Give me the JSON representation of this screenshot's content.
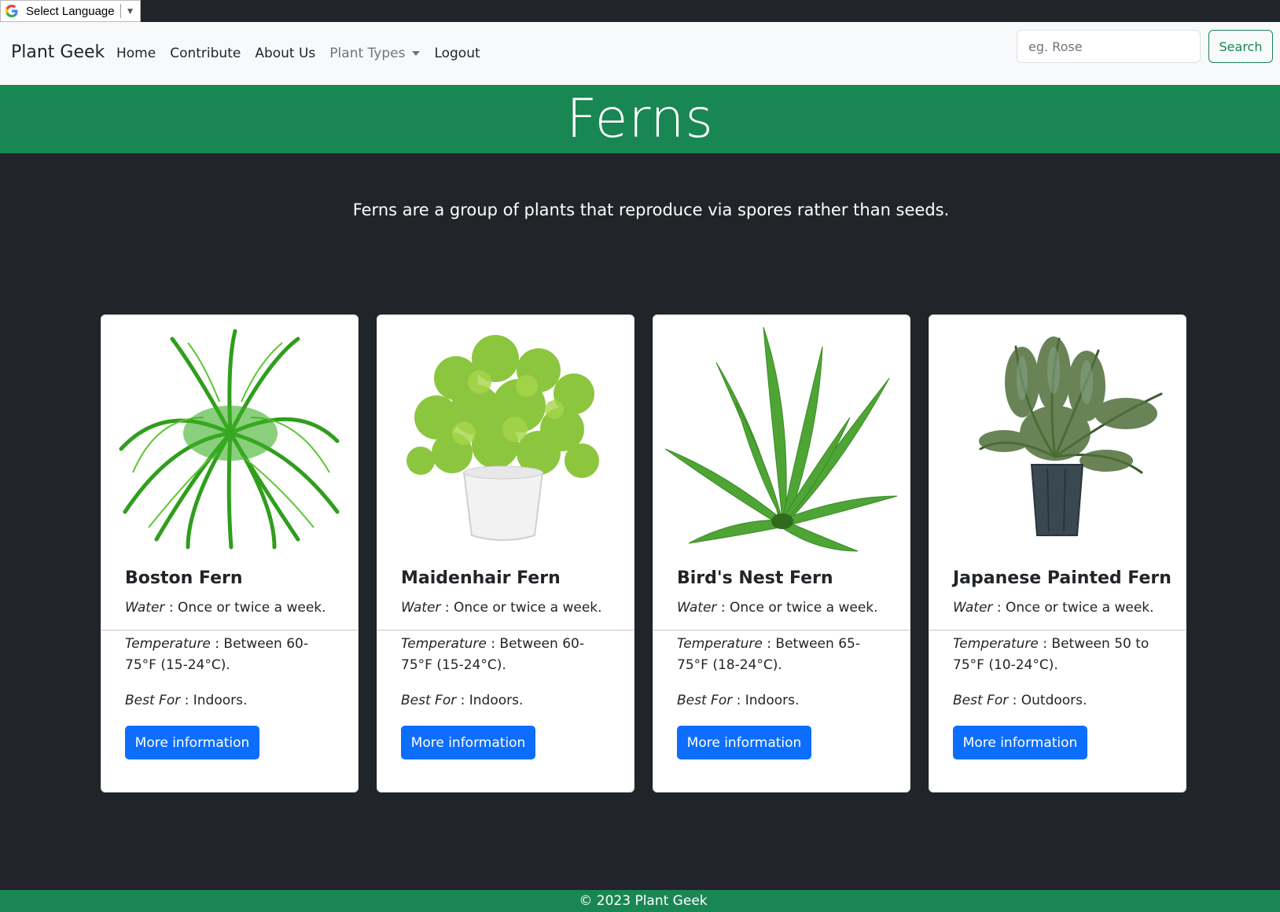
{
  "translate": {
    "label": "Select Language",
    "arrow": "▼"
  },
  "navbar": {
    "brand": "Plant Geek",
    "links": [
      {
        "label": "Home"
      },
      {
        "label": "Contribute"
      },
      {
        "label": "About Us"
      },
      {
        "label": "Plant Types"
      },
      {
        "label": "Logout"
      }
    ],
    "search_placeholder": "eg. Rose",
    "search_label": "Search"
  },
  "hero": {
    "title": "Ferns"
  },
  "intro": "Ferns are a group of plants that reproduce via spores rather than seeds.",
  "labels": {
    "water": "Water",
    "temperature": "Temperature",
    "best_for": "Best For"
  },
  "cards": [
    {
      "title": "Boston Fern",
      "water": "Once or twice a week.",
      "temperature": "Between 60-75°F (15-24°C).",
      "best_for": "Indoors.",
      "button": "More information",
      "image_icon": "boston-fern-image"
    },
    {
      "title": "Maidenhair Fern",
      "water": "Once or twice a week.",
      "temperature": "Between 60-75°F (15-24°C).",
      "best_for": "Indoors.",
      "button": "More information",
      "image_icon": "maidenhair-fern-image"
    },
    {
      "title": "Bird's Nest Fern",
      "water": "Once or twice a week.",
      "temperature": "Between 65-75°F (18-24°C).",
      "best_for": "Indoors.",
      "button": "More information",
      "image_icon": "birds-nest-fern-image"
    },
    {
      "title": "Japanese Painted Fern",
      "water": "Once or twice a week.",
      "temperature": "Between 50 to 75°F (10-24°C).",
      "best_for": "Outdoors.",
      "button": "More information",
      "image_icon": "japanese-painted-fern-image"
    }
  ],
  "footer": {
    "copyright": "© 2023 Plant Geek"
  },
  "colors": {
    "primary": "#0d6efd",
    "success": "#198754",
    "dark": "#212529",
    "light": "#f8f9fa"
  }
}
